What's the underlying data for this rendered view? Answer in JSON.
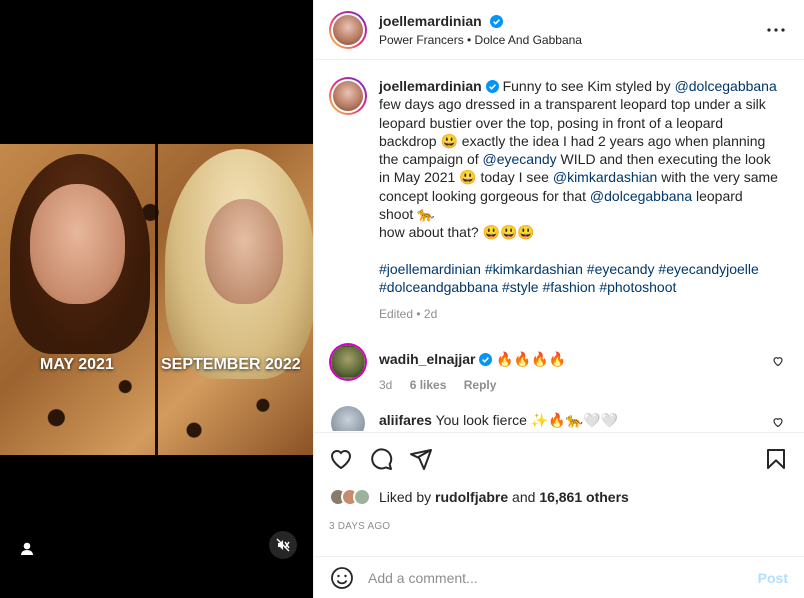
{
  "post": {
    "username": "joellemardinian",
    "subtitle": "Power Francers • Dolce And Gabbana",
    "more_icon": "more-horizontal-icon",
    "media": {
      "label_left": "MAY 2021",
      "label_right": "SEPTEMBER 2022"
    }
  },
  "caption": {
    "username": "joellemardinian",
    "t1": " Funny to see Kim styled by ",
    "m1": "@dolcegabbana",
    "t2": " few days ago dressed in a transparent leopard top under a silk leopard bustier over the top, posing in front of a leopard backdrop 😃 exactly the idea I had 2 years ago when planning the campaign of ",
    "m2": "@eyecandy",
    "t3": " WILD and then executing the look in May 2021 😃 today I see ",
    "m3": "@kimkardashian",
    "t4": " with the very same concept looking gorgeous for that ",
    "m4": "@dolcegabbana",
    "t5": " leopard shoot 🐆",
    "t6": "how about that? 😃😃😃",
    "hashtags": [
      "#joellemardinian",
      "#kimkardashian",
      "#eyecandy",
      "#eyecandyjoelle",
      "#dolceandgabbana",
      "#style",
      "#fashion",
      "#photoshoot"
    ],
    "edited": "Edited • 2d"
  },
  "comments": [
    {
      "username": "wadih_elnajjar",
      "text": "🔥🔥🔥🔥",
      "time": "3d",
      "likes": "6 likes",
      "reply": "Reply"
    },
    {
      "username": "aliifares",
      "text": "You look fierce ✨🔥🐆🤍🤍"
    }
  ],
  "likes": {
    "prefix": "Liked by ",
    "user": "rudolfjabre",
    "middle": " and ",
    "count": "16,861 others"
  },
  "timestamp": "3 DAYS AGO",
  "add_comment": {
    "placeholder": "Add a comment...",
    "post_label": "Post"
  },
  "colors": {
    "link": "#00376b",
    "secondary": "#8e8e8e",
    "verified": "#0095f6",
    "post_disabled": "#b2dffc"
  }
}
